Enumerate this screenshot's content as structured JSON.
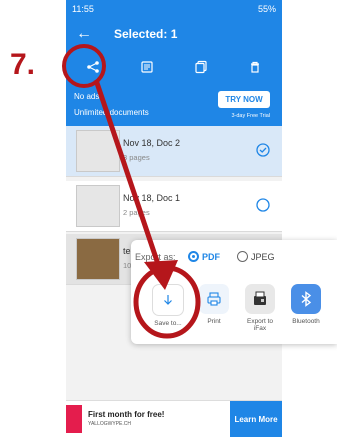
{
  "step_label": "7.",
  "status_bar": {
    "time": "11:55",
    "battery": "55%"
  },
  "header": {
    "title": "Selected: 1"
  },
  "toolbar": {
    "icons": [
      "share-icon",
      "list-icon",
      "copy-icon",
      "trash-icon"
    ]
  },
  "promo": {
    "line1": "No ads",
    "line2": "Unlimited documents",
    "button": "TRY NOW",
    "trial": "3-day Free Trial"
  },
  "documents": [
    {
      "name": "Nov 18, Doc 2",
      "pages": "3 pages",
      "selected": true
    },
    {
      "name": "Nov 18, Doc 1",
      "pages": "2 pages",
      "selected": false
    },
    {
      "name": "te",
      "pages": "10",
      "selected": false
    }
  ],
  "export_sheet": {
    "label": "Export as:",
    "formats": [
      "PDF",
      "JPEG"
    ],
    "selected_format": "PDF",
    "options": [
      {
        "label": "Save to...",
        "icon": "download-icon"
      },
      {
        "label": "Print",
        "icon": "printer-icon"
      },
      {
        "label": "Export to iFax",
        "icon": "fax-icon"
      },
      {
        "label": "Bluetooth",
        "icon": "bluetooth-icon"
      }
    ]
  },
  "ad": {
    "title": "First month for free!",
    "domain": "YALLOGWYPE.CH",
    "button": "Learn More"
  },
  "colors": {
    "primary": "#1f86e6",
    "annotation": "#b5161b"
  }
}
